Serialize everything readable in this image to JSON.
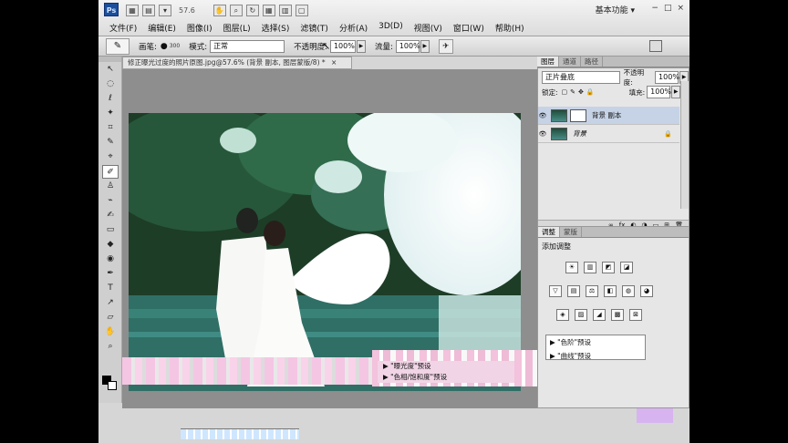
{
  "app": {
    "logo": "Ps",
    "zoom": "57.6",
    "workspace": "基本功能",
    "window_controls": [
      "−",
      "□",
      "×"
    ]
  },
  "menu": [
    "文件(F)",
    "编辑(E)",
    "图像(I)",
    "图层(L)",
    "选择(S)",
    "滤镜(T)",
    "分析(A)",
    "3D(D)",
    "视图(V)",
    "窗口(W)",
    "帮助(H)"
  ],
  "options": {
    "brush_label": "画笔:",
    "brush_size": "300",
    "mode_label": "模式:",
    "mode_value": "正常",
    "opacity_label": "不透明度:",
    "opacity_value": "100%",
    "flow_label": "流量:",
    "flow_value": "100%"
  },
  "document": {
    "tab_title": "修正曝光过度的照片原图.jpg@57.6% (背景 副本, 图层蒙版/8) *",
    "close": "×"
  },
  "tools": [
    "↖",
    "◌",
    "ℓ",
    "✦",
    "⌗",
    "✎",
    "⌖",
    "✐",
    "♙",
    "⌁",
    "✍",
    "▭",
    "◆",
    "◉",
    "✒",
    "T",
    "↗",
    "▱",
    "✋",
    "⌕"
  ],
  "layers_panel": {
    "tabs": [
      "图层",
      "通道",
      "路径"
    ],
    "blend_mode": "正片叠底",
    "opacity_label": "不透明度:",
    "opacity_value": "100%",
    "lock_label": "锁定:",
    "fill_label": "填充:",
    "fill_value": "100%",
    "layers": [
      {
        "name": "背景 副本",
        "selected": true
      },
      {
        "name": "背景",
        "selected": false
      }
    ],
    "footer_icons": [
      "∞",
      "fx",
      "◐",
      "◑",
      "▭",
      "⊞",
      "🗑"
    ]
  },
  "adjustments_panel": {
    "tabs": [
      "调整",
      "蒙版"
    ],
    "title": "添加调整",
    "row1": [
      "☀",
      "▥",
      "◩",
      "◪"
    ],
    "row2": [
      "▽",
      "▤",
      "⚖",
      "◧",
      "◍",
      "◕"
    ],
    "row3": [
      "◈",
      "▨",
      "◢",
      "▩",
      "⊠"
    ],
    "presets": [
      "\"色阶\"预设",
      "\"曲线\"预设",
      "\"曝光度\"预设",
      "\"色相/饱和度\"预设"
    ]
  }
}
